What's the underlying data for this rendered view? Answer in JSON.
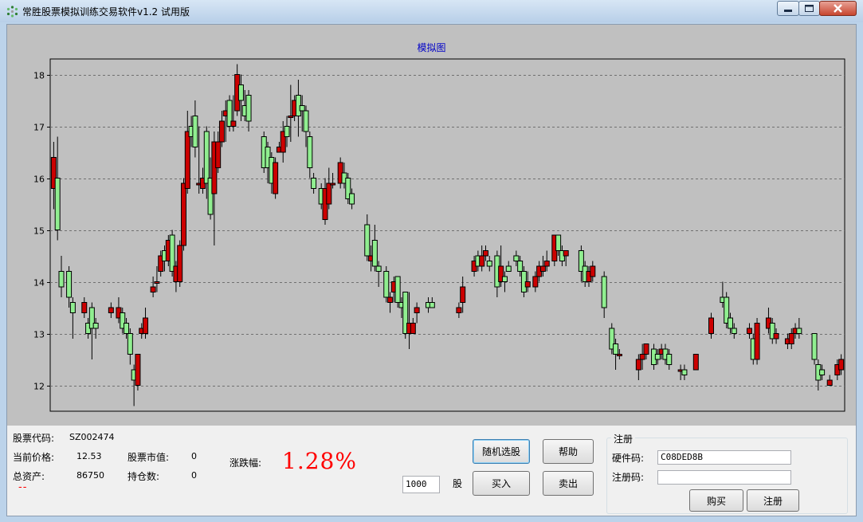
{
  "window": {
    "title": "常胜股票模拟训练交易软件v1.2 试用版"
  },
  "chart": {
    "title": "模拟图"
  },
  "chart_data": {
    "type": "candlestick",
    "title": "模拟图",
    "ylim": [
      11.5,
      18.3
    ],
    "y_ticks": [
      12,
      13,
      14,
      15,
      16,
      17,
      18
    ],
    "grid": "horizontal dashed",
    "colors": {
      "up": "#cc0000",
      "down": "#90ee90",
      "outline": "#000000"
    },
    "candles": [
      [
        15.8,
        16.4,
        15.4,
        16.7
      ],
      [
        16.0,
        15.0,
        14.8,
        16.8
      ],
      [
        14.2,
        13.9,
        13.7,
        14.5
      ],
      null,
      [
        14.2,
        13.7,
        13.5,
        14.3
      ],
      [
        13.6,
        13.4,
        12.9,
        13.7
      ],
      null,
      null,
      [
        13.4,
        13.6,
        13.3,
        13.7
      ],
      [
        13.2,
        13.0,
        12.9,
        13.3
      ],
      [
        13.5,
        13.1,
        12.5,
        13.6
      ],
      [
        13.2,
        13.1,
        12.9,
        13.3
      ],
      null,
      null,
      null,
      [
        13.4,
        13.5,
        13.3,
        13.6
      ],
      null,
      [
        13.3,
        13.5,
        13.2,
        13.7
      ],
      [
        13.4,
        13.1,
        13.0,
        13.5
      ],
      [
        13.2,
        13.0,
        12.9,
        13.3
      ],
      [
        13.0,
        12.6,
        12.4,
        13.1
      ],
      [
        12.3,
        12.1,
        11.6,
        12.4
      ],
      [
        12.0,
        12.6,
        11.9,
        12.6
      ],
      [
        13.0,
        13.1,
        12.9,
        13.2
      ],
      [
        13.0,
        13.3,
        12.9,
        13.5
      ],
      null,
      [
        13.8,
        13.9,
        13.7,
        14.1
      ],
      [
        14.0,
        14.0,
        13.8,
        14.3
      ],
      [
        14.2,
        14.5,
        14.1,
        14.6
      ],
      [
        14.6,
        14.4,
        14.2,
        14.7
      ],
      [
        14.4,
        14.8,
        14.3,
        14.9
      ],
      [
        14.9,
        14.2,
        14.1,
        15.0
      ],
      [
        14.0,
        14.3,
        13.8,
        14.4
      ],
      [
        14.0,
        14.7,
        13.9,
        14.8
      ],
      [
        14.7,
        15.9,
        14.6,
        16.0
      ],
      [
        15.8,
        16.9,
        15.7,
        17.3
      ],
      [
        17.0,
        16.8,
        16.6,
        17.2
      ],
      [
        17.2,
        16.6,
        16.4,
        17.5
      ],
      [
        15.9,
        15.9,
        15.7,
        17.0
      ],
      [
        15.8,
        16.0,
        15.7,
        16.2
      ],
      [
        16.9,
        15.9,
        15.6,
        17.0
      ],
      [
        16.0,
        15.3,
        15.2,
        16.4
      ],
      [
        15.7,
        16.7,
        14.7,
        16.9
      ],
      [
        16.2,
        16.7,
        16.1,
        16.9
      ],
      [
        16.7,
        17.1,
        16.6,
        17.3
      ],
      [
        17.2,
        17.3,
        16.7,
        17.5
      ],
      [
        17.5,
        17.0,
        16.9,
        17.6
      ],
      [
        17.0,
        17.1,
        16.9,
        17.6
      ],
      [
        17.3,
        18.0,
        17.2,
        18.2
      ],
      [
        17.8,
        17.5,
        17.1,
        18.0
      ],
      [
        17.4,
        17.2,
        17.1,
        17.7
      ],
      [
        17.6,
        17.1,
        16.9,
        17.7
      ],
      null,
      null,
      null,
      [
        16.8,
        16.2,
        16.1,
        16.9
      ],
      [
        16.6,
        16.2,
        15.9,
        16.7
      ],
      [
        16.4,
        15.9,
        15.7,
        16.5
      ],
      [
        15.7,
        16.3,
        15.6,
        16.4
      ],
      [
        16.5,
        16.6,
        16.5,
        16.7
      ],
      [
        16.5,
        16.9,
        16.3,
        17.1
      ],
      [
        17.0,
        16.8,
        16.6,
        17.2
      ],
      [
        17.2,
        17.2,
        16.7,
        17.8
      ],
      [
        17.2,
        17.5,
        17.1,
        17.6
      ],
      [
        17.6,
        17.2,
        16.8,
        17.9
      ],
      [
        17.4,
        17.3,
        16.9,
        17.6
      ],
      [
        17.3,
        16.9,
        16.6,
        17.4
      ],
      [
        16.8,
        16.2,
        16.0,
        16.9
      ],
      [
        16.0,
        15.8,
        15.7,
        16.1
      ],
      null,
      [
        15.8,
        15.5,
        15.4,
        15.9
      ],
      [
        15.2,
        15.8,
        15.1,
        16.0
      ],
      [
        15.5,
        15.9,
        15.4,
        16.2
      ],
      [
        15.9,
        15.9,
        15.8,
        16.1
      ],
      null,
      [
        15.9,
        16.3,
        15.8,
        16.4
      ],
      [
        16.1,
        15.9,
        15.8,
        16.3
      ],
      [
        16.0,
        15.6,
        15.5,
        16.1
      ],
      [
        15.7,
        15.5,
        15.4,
        15.8
      ],
      null,
      null,
      null,
      [
        15.1,
        14.5,
        14.4,
        15.3
      ],
      [
        14.4,
        14.5,
        14.2,
        14.7
      ],
      [
        14.8,
        14.3,
        14.2,
        15.1
      ],
      [
        14.3,
        14.2,
        13.9,
        14.4
      ],
      null,
      [
        14.2,
        13.7,
        13.6,
        14.3
      ],
      [
        13.6,
        13.7,
        13.4,
        13.8
      ],
      [
        13.8,
        14.0,
        13.6,
        14.1
      ],
      [
        14.1,
        13.6,
        13.5,
        14.1
      ],
      [
        13.6,
        13.5,
        13.3,
        13.7
      ],
      [
        13.8,
        13.0,
        12.9,
        13.8
      ],
      [
        13.0,
        13.2,
        12.7,
        13.8
      ],
      [
        13.0,
        13.2,
        13.0,
        13.3
      ],
      [
        13.4,
        13.5,
        13.2,
        13.6
      ],
      null,
      null,
      [
        13.6,
        13.5,
        13.4,
        13.7
      ],
      [
        13.6,
        13.5,
        13.5,
        13.7
      ],
      null,
      null,
      null,
      null,
      null,
      null,
      [
        13.4,
        13.5,
        13.3,
        13.6
      ],
      [
        13.6,
        13.9,
        13.4,
        14.1
      ],
      null,
      null,
      [
        14.2,
        14.4,
        14.1,
        14.5
      ],
      [
        14.5,
        14.3,
        14.2,
        14.6
      ],
      [
        14.3,
        14.5,
        14.2,
        14.7
      ],
      [
        14.5,
        14.6,
        14.4,
        14.7
      ],
      [
        14.4,
        14.3,
        14.2,
        14.5
      ],
      null,
      [
        14.5,
        13.9,
        13.7,
        14.6
      ],
      [
        14.0,
        14.3,
        13.9,
        14.7
      ],
      [
        14.1,
        14.0,
        13.8,
        14.2
      ],
      [
        14.3,
        14.2,
        14.2,
        14.4
      ],
      null,
      [
        14.5,
        14.4,
        14.3,
        14.6
      ],
      [
        14.4,
        14.2,
        14.1,
        14.5
      ],
      [
        14.2,
        13.8,
        13.7,
        14.3
      ],
      [
        13.9,
        14.0,
        13.8,
        14.2
      ],
      null,
      [
        13.9,
        14.1,
        13.8,
        14.2
      ],
      [
        14.1,
        14.3,
        14.0,
        14.4
      ],
      [
        14.2,
        14.3,
        14.1,
        14.5
      ],
      [
        14.3,
        14.4,
        14.2,
        14.6
      ],
      null,
      [
        14.4,
        14.9,
        14.3,
        14.9
      ],
      [
        14.9,
        14.6,
        14.5,
        14.9
      ],
      [
        14.6,
        14.4,
        14.3,
        14.7
      ],
      [
        14.5,
        14.6,
        14.3,
        14.6
      ],
      null,
      null,
      null,
      [
        14.6,
        14.2,
        14.0,
        14.7
      ],
      [
        14.3,
        14.0,
        13.9,
        14.4
      ],
      [
        14.0,
        14.2,
        13.9,
        14.3
      ],
      [
        14.1,
        14.3,
        14.0,
        14.4
      ],
      null,
      null,
      [
        14.1,
        13.5,
        13.3,
        14.2
      ],
      null,
      [
        13.1,
        12.7,
        12.6,
        13.2
      ],
      [
        12.8,
        12.6,
        12.3,
        12.9
      ],
      [
        12.6,
        12.6,
        12.5,
        12.7
      ],
      null,
      null,
      null,
      null,
      [
        12.3,
        12.5,
        12.1,
        12.6
      ],
      [
        12.5,
        12.6,
        12.3,
        12.8
      ],
      [
        12.6,
        12.8,
        12.5,
        12.8
      ],
      null,
      [
        12.7,
        12.4,
        12.3,
        12.8
      ],
      [
        12.6,
        12.5,
        12.4,
        12.7
      ],
      [
        12.6,
        12.7,
        12.5,
        12.8
      ],
      [
        12.7,
        12.5,
        12.4,
        12.8
      ],
      [
        12.6,
        12.4,
        12.3,
        12.7
      ],
      null,
      null,
      [
        12.3,
        12.3,
        12.1,
        12.4
      ],
      [
        12.3,
        12.2,
        12.1,
        12.4
      ],
      null,
      null,
      [
        12.3,
        12.6,
        12.3,
        12.6
      ],
      null,
      null,
      null,
      [
        13.0,
        13.3,
        12.9,
        13.4
      ],
      null,
      null,
      [
        13.7,
        13.6,
        13.5,
        14.0
      ],
      [
        13.7,
        13.2,
        13.1,
        13.8
      ],
      [
        13.3,
        13.1,
        13.0,
        13.4
      ],
      [
        13.1,
        13.0,
        12.9,
        13.2
      ],
      null,
      null,
      null,
      [
        13.0,
        13.1,
        12.9,
        13.2
      ],
      [
        12.9,
        12.5,
        12.4,
        13.0
      ],
      [
        12.5,
        13.2,
        12.4,
        13.3
      ],
      null,
      null,
      [
        13.1,
        13.3,
        13.0,
        13.5
      ],
      [
        13.2,
        12.9,
        12.8,
        13.3
      ],
      [
        12.9,
        13.0,
        12.8,
        13.1
      ],
      null,
      null,
      [
        12.8,
        12.9,
        12.7,
        13.0
      ],
      [
        12.8,
        13.0,
        12.7,
        13.1
      ],
      [
        13.0,
        13.1,
        12.9,
        13.2
      ],
      [
        13.1,
        13.0,
        12.9,
        13.3
      ],
      null,
      null,
      null,
      [
        13.0,
        12.5,
        12.4,
        13.0
      ],
      [
        12.4,
        12.1,
        11.9,
        12.5
      ],
      [
        12.3,
        12.2,
        12.1,
        12.4
      ],
      null,
      [
        12.0,
        12.1,
        12.0,
        12.2
      ],
      null,
      [
        12.2,
        12.4,
        12.1,
        12.5
      ],
      [
        12.3,
        12.5,
        12.2,
        12.6
      ]
    ]
  },
  "stock": {
    "code_label": "股票代码:",
    "code_value": "SZ002474",
    "price_label": "当前价格:",
    "price_value": "12.53",
    "market_label": "股票市值:",
    "market_value": "0",
    "assets_label": "总资产:",
    "assets_value": "86750",
    "hold_label": "持仓数:",
    "hold_value": "0",
    "change_label": "涨跌幅:",
    "change_value": "1.28%",
    "status_text": "--"
  },
  "trade": {
    "quantity_value": "1000",
    "unit_label": "股",
    "random_select_label": "随机选股",
    "help_label": "帮助",
    "buy_label": "买入",
    "sell_label": "卖出"
  },
  "register": {
    "group_title": "注册",
    "hardware_label": "硬件码:",
    "hardware_value": "C08DED8B",
    "regcode_label": "注册码:",
    "regcode_value": "",
    "purchase_label": "购买",
    "register_label": "注册"
  }
}
